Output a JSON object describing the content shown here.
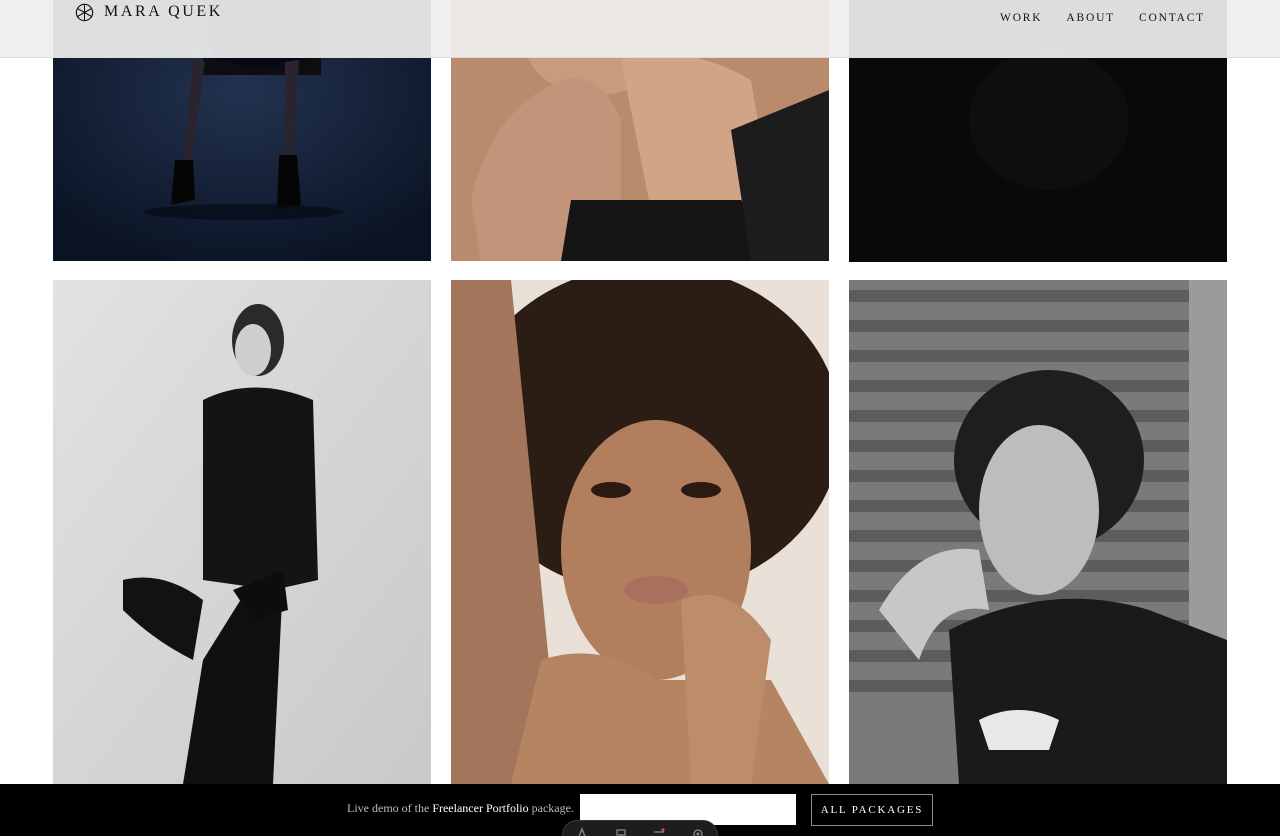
{
  "header": {
    "brand": "MARA QUEK",
    "logo_icon": "asterisk-circle-icon",
    "nav": [
      {
        "label": "WORK"
      },
      {
        "label": "ABOUT"
      },
      {
        "label": "CONTACT"
      }
    ]
  },
  "gallery": {
    "tiles": [
      {
        "subject": "model legs in black heels on dark blue background",
        "tone": "#0f1a2e"
      },
      {
        "subject": "close-up of hand resting under chin, black sweater",
        "tone": "#c79a7e"
      },
      {
        "subject": "near-black dark frame",
        "tone": "#0a0a0a"
      },
      {
        "subject": "black and white model in black suit posing against grey wall",
        "tone": "#d6d6d6"
      },
      {
        "subject": "portrait of woman with curly hair and freckles",
        "tone": "#b78462"
      },
      {
        "subject": "black and white portrait of woman by window shutters",
        "tone": "#8a8a8a"
      }
    ]
  },
  "demo_bar": {
    "text_prefix": "Live demo of the ",
    "text_strong": "Freelancer Portfolio",
    "text_suffix": " package.",
    "input_value": "",
    "button_label": "ALL PACKAGES"
  },
  "tool_pill": {
    "icons": [
      "text-icon",
      "paint-icon",
      "layers-icon",
      "settings-icon"
    ]
  },
  "colors": {
    "header_bg": "#eeeeee",
    "bar_bg": "#000000",
    "text": "#111111"
  }
}
